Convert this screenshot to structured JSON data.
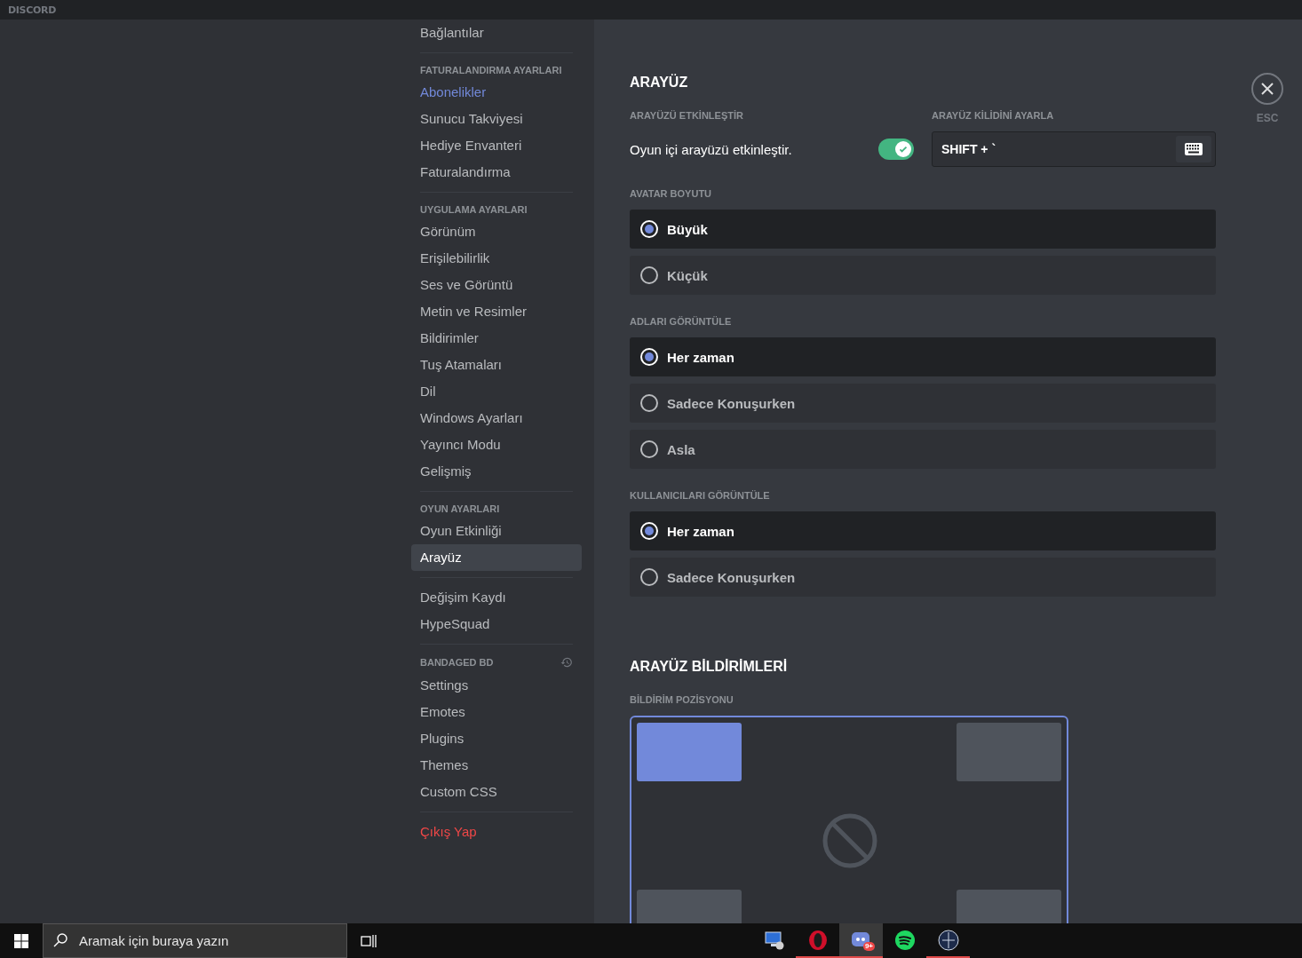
{
  "titlebar": {
    "logo": "DISCORD"
  },
  "sidebar": {
    "sections": [
      {
        "items": [
          {
            "label": "Bağlantılar",
            "kind": "normal",
            "selected": false
          }
        ]
      },
      {
        "header": "FATURALANDIRMA AYARLARI",
        "items": [
          {
            "label": "Abonelikler",
            "kind": "premium",
            "selected": false
          },
          {
            "label": "Sunucu Takviyesi",
            "kind": "normal",
            "selected": false
          },
          {
            "label": "Hediye Envanteri",
            "kind": "normal",
            "selected": false
          },
          {
            "label": "Faturalandırma",
            "kind": "normal",
            "selected": false
          }
        ]
      },
      {
        "header": "UYGULAMA AYARLARI",
        "items": [
          {
            "label": "Görünüm",
            "kind": "normal",
            "selected": false
          },
          {
            "label": "Erişilebilirlik",
            "kind": "normal",
            "selected": false
          },
          {
            "label": "Ses ve Görüntü",
            "kind": "normal",
            "selected": false
          },
          {
            "label": "Metin ve Resimler",
            "kind": "normal",
            "selected": false
          },
          {
            "label": "Bildirimler",
            "kind": "normal",
            "selected": false
          },
          {
            "label": "Tuş Atamaları",
            "kind": "normal",
            "selected": false
          },
          {
            "label": "Dil",
            "kind": "normal",
            "selected": false
          },
          {
            "label": "Windows Ayarları",
            "kind": "normal",
            "selected": false
          },
          {
            "label": "Yayıncı Modu",
            "kind": "normal",
            "selected": false
          },
          {
            "label": "Gelişmiş",
            "kind": "normal",
            "selected": false
          }
        ]
      },
      {
        "header": "OYUN AYARLARI",
        "items": [
          {
            "label": "Oyun Etkinliği",
            "kind": "normal",
            "selected": false
          },
          {
            "label": "Arayüz",
            "kind": "normal",
            "selected": true
          }
        ]
      },
      {
        "items": [
          {
            "label": "Değişim Kaydı",
            "kind": "normal",
            "selected": false
          },
          {
            "label": "HypeSquad",
            "kind": "normal",
            "selected": false
          }
        ]
      },
      {
        "header": "BANDAGED BD",
        "header_icon": true,
        "items": [
          {
            "label": "Settings",
            "kind": "normal",
            "selected": false
          },
          {
            "label": "Emotes",
            "kind": "normal",
            "selected": false
          },
          {
            "label": "Plugins",
            "kind": "normal",
            "selected": false
          },
          {
            "label": "Themes",
            "kind": "normal",
            "selected": false
          },
          {
            "label": "Custom CSS",
            "kind": "normal",
            "selected": false
          }
        ]
      },
      {
        "items": [
          {
            "label": "Çıkış Yap",
            "kind": "danger",
            "selected": false
          }
        ]
      }
    ]
  },
  "overlay": {
    "title": "ARAYÜZ",
    "enable": {
      "header": "ARAYÜZÜ ETKİNLEŞTİR",
      "label": "Oyun içi arayüzü etkinleştir.",
      "on": true
    },
    "keybind": {
      "header": "ARAYÜZ KİLİDİNİ AYARLA",
      "value": "SHIFT + `"
    },
    "groups": [
      {
        "header": "AVATAR BOYUTU",
        "options": [
          {
            "label": "Büyük",
            "selected": true
          },
          {
            "label": "Küçük",
            "selected": false
          }
        ]
      },
      {
        "header": "ADLARI GÖRÜNTÜLE",
        "options": [
          {
            "label": "Her zaman",
            "selected": true
          },
          {
            "label": "Sadece Konuşurken",
            "selected": false
          },
          {
            "label": "Asla",
            "selected": false
          }
        ]
      },
      {
        "header": "KULLANICILARI GÖRÜNTÜLE",
        "options": [
          {
            "label": "Her zaman",
            "selected": true
          },
          {
            "label": "Sadece Konuşurken",
            "selected": false
          }
        ]
      }
    ]
  },
  "notifications": {
    "title": "ARAYÜZ BİLDİRİMLERİ",
    "header": "BİLDİRİM POZİSYONU",
    "positions": [
      {
        "selected": true
      },
      {
        "selected": false
      },
      {
        "selected": false
      },
      {
        "selected": false
      }
    ]
  },
  "close": {
    "label": "ESC"
  },
  "taskbar": {
    "search": {
      "placeholder": "Aramak için buraya yazın"
    },
    "apps": [
      {
        "kind": "network",
        "running": false,
        "active": false
      },
      {
        "kind": "opera",
        "running": true,
        "active": false
      },
      {
        "kind": "discord",
        "running": true,
        "active": true,
        "badge": "9+"
      },
      {
        "kind": "spotify",
        "running": false,
        "active": false
      },
      {
        "kind": "edu",
        "running": true,
        "active": false
      }
    ]
  }
}
